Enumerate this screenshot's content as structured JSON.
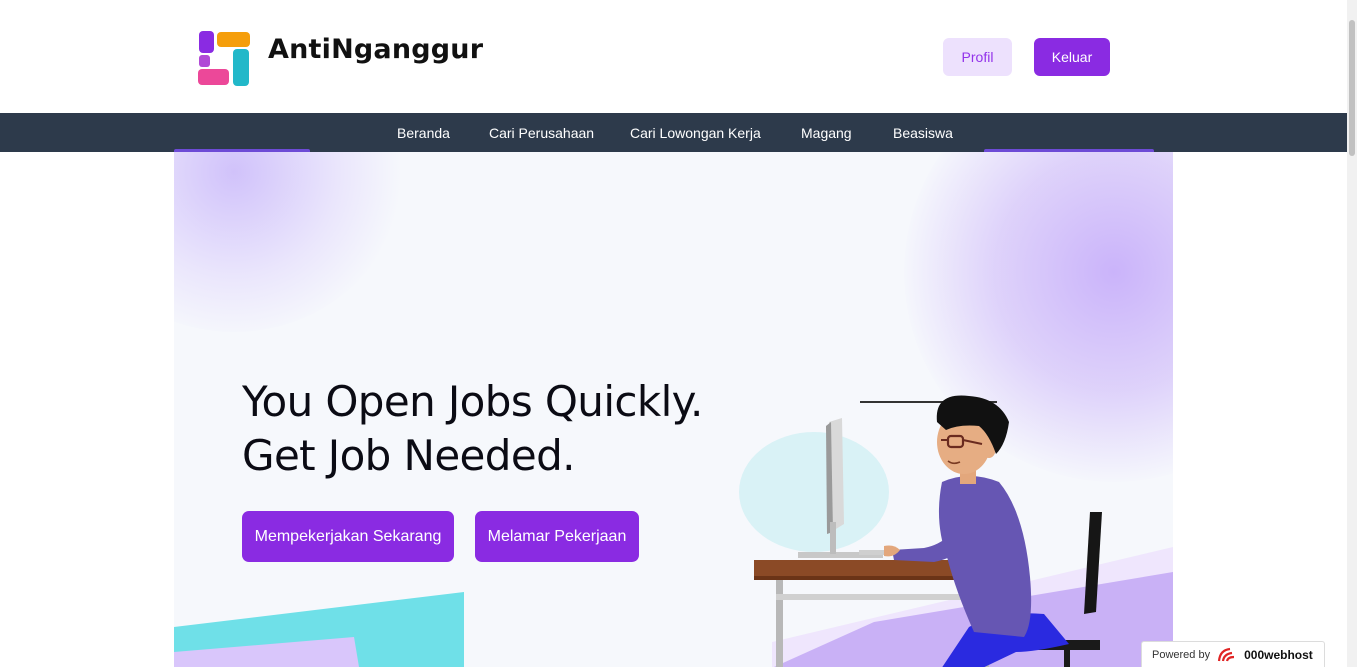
{
  "header": {
    "brand": "AntiNganggur",
    "profile_label": "Profil",
    "logout_label": "Keluar"
  },
  "nav": {
    "items": [
      "Beranda",
      "Cari Perusahaan",
      "Cari Lowongan Kerja",
      "Magang",
      "Beasiswa"
    ]
  },
  "hero": {
    "title_line1": "You Open Jobs Quickly.",
    "title_line2": "Get Job Needed.",
    "hire_label": "Mempekerjakan Sekarang",
    "apply_label": "Melamar Pekerjaan"
  },
  "footer_badge": {
    "powered_by": "Powered by",
    "host": "000webhost"
  },
  "colors": {
    "accent": "#8a2be2",
    "nav_bg": "#2d3a4b",
    "hero_bg": "#f6f8fc",
    "profile_bg": "#ede1fd"
  },
  "icons": {
    "logo": "antinganggur-logo-icon",
    "host_logo": "000webhost-logo-icon"
  }
}
